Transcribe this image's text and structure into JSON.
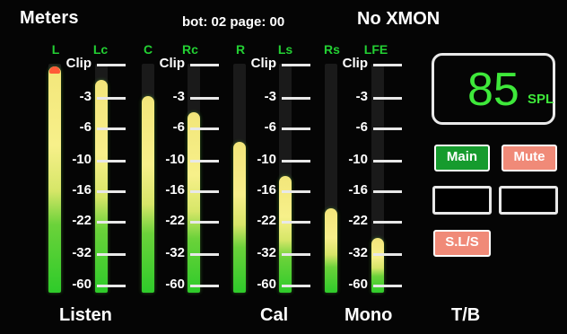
{
  "header": {
    "title": "Meters",
    "bot_page": "bot: 02  page: 00",
    "xmon": "No XMON"
  },
  "channels": [
    {
      "label": "L",
      "level": 0.99,
      "peak": true
    },
    {
      "label": "Lc",
      "level": 0.93,
      "peak": false
    },
    {
      "label": "C",
      "level": 0.86,
      "peak": false
    },
    {
      "label": "Rc",
      "level": 0.79,
      "peak": false
    },
    {
      "label": "R",
      "level": 0.66,
      "peak": false
    },
    {
      "label": "Ls",
      "level": 0.51,
      "peak": false
    },
    {
      "label": "Rs",
      "level": 0.37,
      "peak": false
    },
    {
      "label": "LFE",
      "level": 0.24,
      "peak": false
    }
  ],
  "scale_ticks": [
    "Clip",
    "-3",
    "-6",
    "-10",
    "-16",
    "-22",
    "-32",
    "-60"
  ],
  "spl": {
    "value": "85",
    "unit": "SPL"
  },
  "buttons": {
    "main": "Main",
    "mute": "Mute",
    "sls": "S.L/S"
  },
  "bottom": {
    "listen": "Listen",
    "cal": "Cal",
    "mono": "Mono",
    "tb": "T/B"
  }
}
